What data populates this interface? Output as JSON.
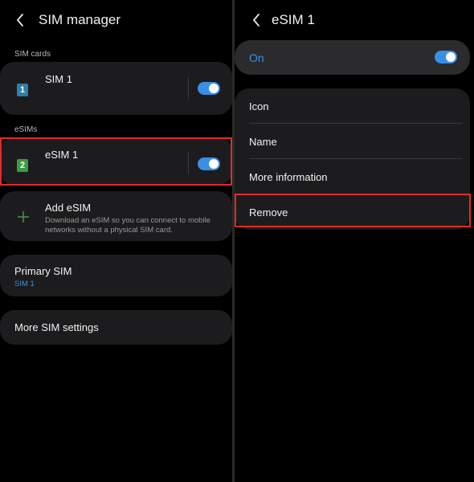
{
  "left": {
    "header": {
      "title": "SIM manager"
    },
    "sim_cards_label": "SIM cards",
    "sim1": {
      "name": "SIM 1",
      "badge": "1",
      "badge_color": "#2f7fa8",
      "enabled": true
    },
    "esims_label": "eSIMs",
    "esim1": {
      "name": "eSIM 1",
      "badge": "2",
      "badge_color": "#3f9a44",
      "enabled": true
    },
    "add_esim": {
      "title": "Add eSIM",
      "line1": "Download an eSIM so you can connect to mobile",
      "line2": "networks without a physical SIM card."
    },
    "primary_sim": {
      "title": "Primary SIM",
      "value": "SIM 1"
    },
    "more_settings": {
      "title": "More SIM settings"
    }
  },
  "right": {
    "header": {
      "title": "eSIM 1"
    },
    "on_switch": {
      "label": "On",
      "enabled": true
    },
    "menu": {
      "icon": "Icon",
      "name": "Name",
      "more_info": "More information",
      "remove": "Remove"
    }
  },
  "colors": {
    "accent": "#3a8ee6",
    "highlight": "#e22a2a",
    "card": "#1c1c1e"
  }
}
